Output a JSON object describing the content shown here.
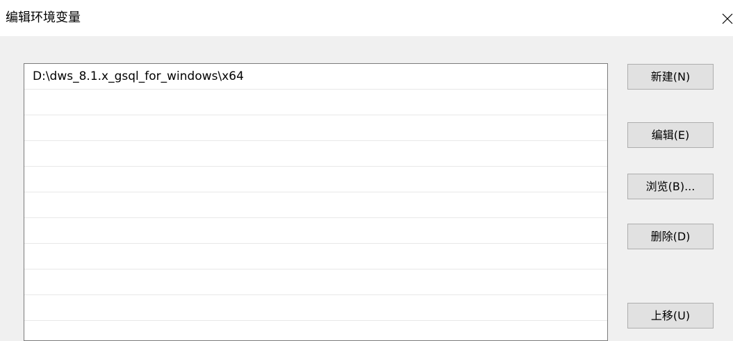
{
  "window": {
    "title": "编辑环境变量",
    "close_glyph": "×"
  },
  "list": {
    "items": [
      "D:\\dws_8.1.x_gsql_for_windows\\x64",
      "",
      "",
      "",
      "",
      "",
      "",
      "",
      "",
      "",
      ""
    ]
  },
  "buttons": {
    "new_label": "新建(N)",
    "edit_label": "编辑(E)",
    "browse_label": "浏览(B)...",
    "delete_label": "删除(D)",
    "move_up_label": "上移(U)"
  },
  "colors": {
    "dialog_background": "#f0f0f0",
    "titlebar_background": "#ffffff",
    "button_face": "#e1e1e1",
    "button_border": "#adadad",
    "list_border": "#7a7a7a",
    "row_divider": "#e8e8e8"
  }
}
